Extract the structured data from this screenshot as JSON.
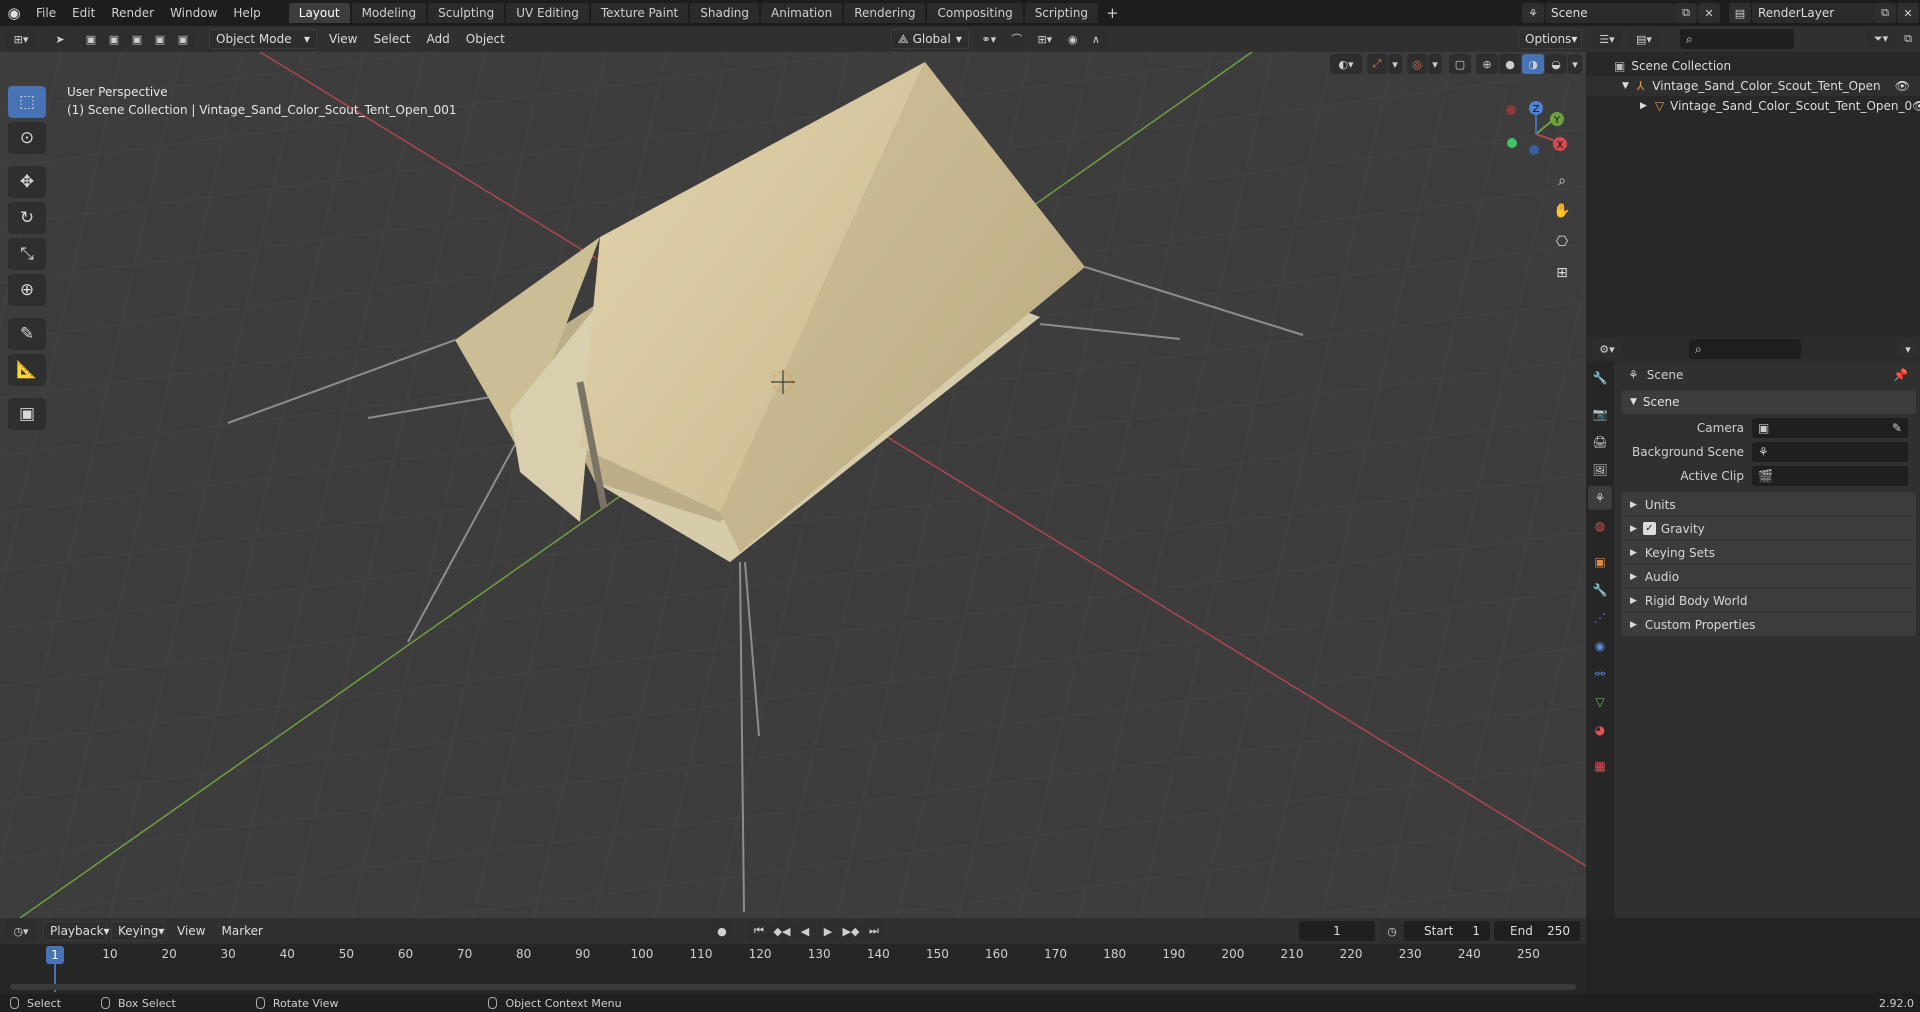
{
  "topbar": {
    "menus": [
      "File",
      "Edit",
      "Render",
      "Window",
      "Help"
    ],
    "workspaces": [
      "Layout",
      "Modeling",
      "Sculpting",
      "UV Editing",
      "Texture Paint",
      "Shading",
      "Animation",
      "Rendering",
      "Compositing",
      "Scripting"
    ],
    "active_workspace": "Layout",
    "scene_name": "Scene",
    "render_layer": "RenderLayer"
  },
  "viewport_header": {
    "mode": "Object Mode",
    "menus": [
      "View",
      "Select",
      "Add",
      "Object"
    ],
    "orientation": "Global",
    "options_label": "Options"
  },
  "viewport": {
    "view_name": "User Perspective",
    "collection_info": "(1) Scene Collection | Vintage_Sand_Color_Scout_Tent_Open_001",
    "tent_color": "#d8c9a0",
    "grid_color": "#474747",
    "x_axis_color": "#b0464c",
    "y_axis_color": "#6ea040",
    "gizmo": {
      "x": "X",
      "y": "Y",
      "z": "Z"
    }
  },
  "outliner": {
    "root": "Scene Collection",
    "items": [
      {
        "label": "Vintage_Sand_Color_Scout_Tent_Open"
      },
      {
        "label": "Vintage_Sand_Color_Scout_Tent_Open_0"
      }
    ]
  },
  "properties": {
    "header_title": "Scene",
    "panel_title": "Scene",
    "fields": [
      {
        "label": "Camera"
      },
      {
        "label": "Background Scene"
      },
      {
        "label": "Active Clip"
      }
    ],
    "subpanels": [
      "Units",
      "Gravity",
      "Keying Sets",
      "Audio",
      "Rigid Body World",
      "Custom Properties"
    ],
    "gravity_checked": true
  },
  "timeline": {
    "menus": [
      "Playback",
      "Keying",
      "View",
      "Marker"
    ],
    "current_frame": "1",
    "start_label": "Start",
    "start": "1",
    "end_label": "End",
    "end": "250",
    "ruler_labels": [
      "10",
      "20",
      "30",
      "40",
      "50",
      "60",
      "70",
      "80",
      "90",
      "100",
      "110",
      "120",
      "130",
      "140",
      "150",
      "160",
      "170",
      "180",
      "190",
      "200",
      "210",
      "220",
      "230",
      "240",
      "250"
    ],
    "current_marker": "1"
  },
  "statusbar": {
    "items": [
      "Select",
      "Box Select",
      "Rotate View",
      "Object Context Menu"
    ],
    "version": "2.92.0"
  }
}
